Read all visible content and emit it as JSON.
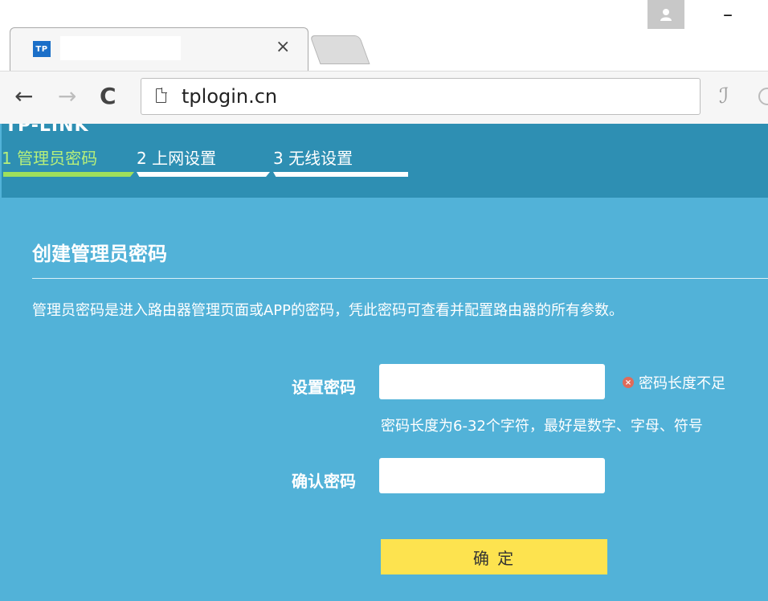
{
  "browser": {
    "tab": {
      "favicon_text": "TP",
      "close_glyph": "×"
    },
    "url": "tplogin.cn",
    "nav": {
      "back": "←",
      "forward": "→",
      "reload": "C"
    },
    "extension_glyph": "ℐ",
    "minimize_glyph": "–"
  },
  "wizard": {
    "brand_fragment": "TP-LINK",
    "steps": [
      {
        "label": "1 管理员密码",
        "state": "active"
      },
      {
        "label": "2 上网设置",
        "state": "pending"
      },
      {
        "label": "3 无线设置",
        "state": "pending"
      }
    ]
  },
  "form": {
    "title": "创建管理员密码",
    "description": "管理员密码是进入路由器管理页面或APP的密码，凭此密码可查看并配置路由器的所有参数。",
    "set_password": {
      "label": "设置密码",
      "value": "",
      "error": "密码长度不足",
      "error_icon": "×"
    },
    "hint": "密码长度为6-32个字符，最好是数字、字母、符号",
    "confirm_password": {
      "label": "确认密码",
      "value": ""
    },
    "submit_label": "确 定"
  },
  "colors": {
    "page_bg": "#52b2d8",
    "header_bg": "#2e8fb3",
    "active_step": "#9fe05c",
    "button": "#fde34f",
    "error_icon": "#e06b5a"
  }
}
